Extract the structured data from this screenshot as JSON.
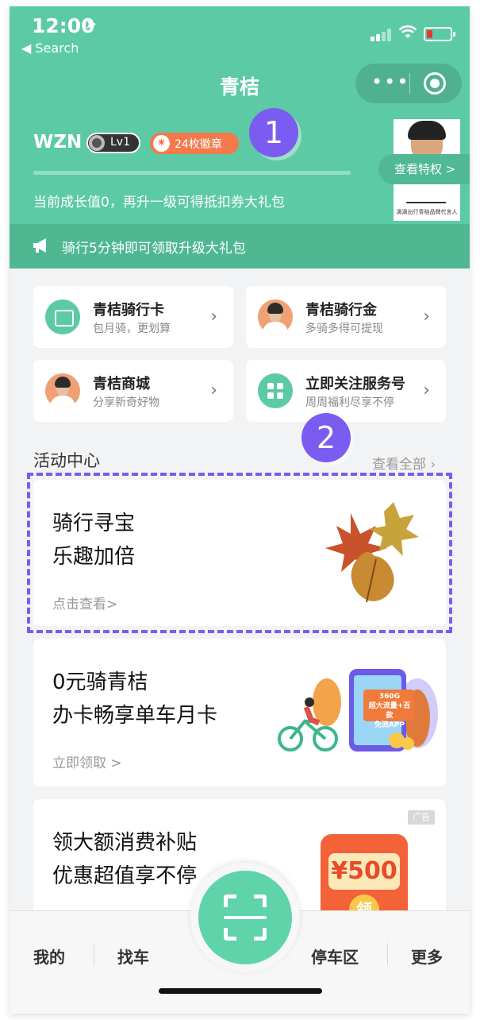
{
  "status_bar": {
    "time": "12:00",
    "back_label": "◀ Search"
  },
  "nav": {
    "title": "青桔",
    "more_icon": "more-dots-icon",
    "close_icon": "target-icon"
  },
  "user": {
    "name": "WZN",
    "level": "Lv1",
    "medals": "24枚徽章",
    "growth_text": "当前成长值0，再升一级可得抵扣券大礼包",
    "view_privileges": "查看特权",
    "ambassador_caption": "滴滴出行青桔品牌代言人"
  },
  "notice": {
    "text": "骑行5分钟即可领取升级大礼包"
  },
  "callouts": {
    "one": "1",
    "two": "2"
  },
  "grid": [
    {
      "title": "青桔骑行卡",
      "sub": "包月骑，更划算"
    },
    {
      "title": "青桔骑行金",
      "sub": "多骑多得可提现"
    },
    {
      "title": "青桔商城",
      "sub": "分享新奇好物"
    },
    {
      "title": "立即关注服务号",
      "sub": "周周福利尽享不停"
    }
  ],
  "activity": {
    "section_title": "活动中心",
    "view_all": "查看全部",
    "cards": [
      {
        "line1": "骑行寻宝",
        "line2": "乐趣加倍",
        "link": "点击查看>"
      },
      {
        "line1": "0元骑青桔",
        "line2": "办卡畅享单车月卡",
        "link": "立即领取 >",
        "promo_line1": "360G",
        "promo_line2": "超大流量+百款",
        "promo_line3": "免流APP"
      },
      {
        "line1": "领大额消费补贴",
        "line2": "优惠超值享不停",
        "ad_tag": "广告",
        "envelope_amount": "¥500",
        "envelope_btn": "领"
      }
    ]
  },
  "tabbar": {
    "mine": "我的",
    "find_bike": "找车",
    "parking": "停车区",
    "more": "更多"
  },
  "colors": {
    "brand_green": "#5ccaa5",
    "callout_purple": "#7b5cf0"
  }
}
